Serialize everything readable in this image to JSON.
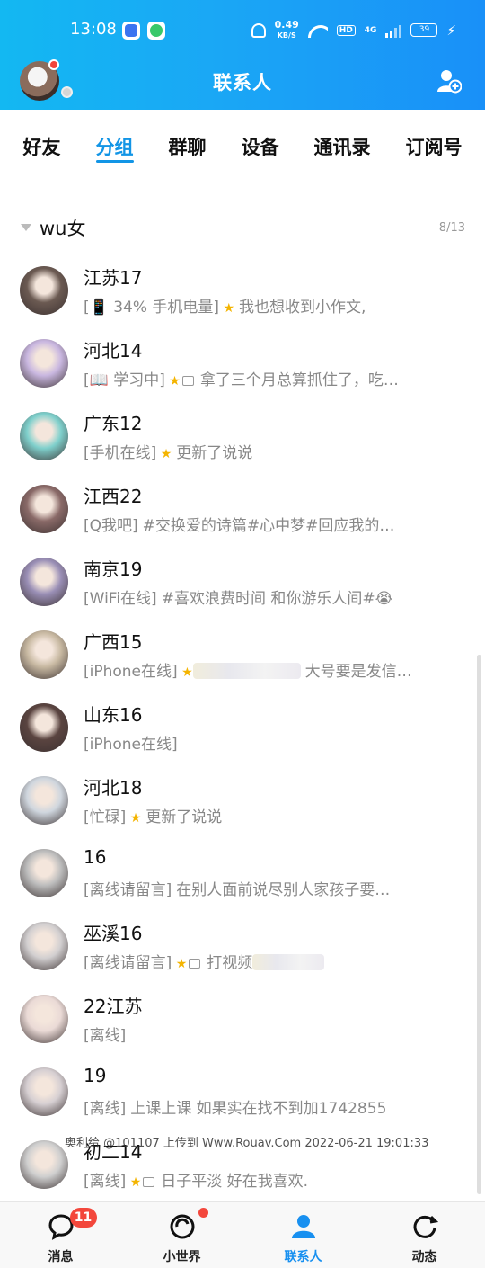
{
  "status_bar": {
    "time": "13:08",
    "net_speed_value": "0.49",
    "net_speed_unit": "KB/S",
    "hd": "HD",
    "signal": "4G",
    "battery": "39"
  },
  "header": {
    "title": "联系人"
  },
  "tabs": [
    {
      "label": "好友",
      "active": false
    },
    {
      "label": "分组",
      "active": true
    },
    {
      "label": "群聊",
      "active": false
    },
    {
      "label": "设备",
      "active": false
    },
    {
      "label": "通讯录",
      "active": false
    },
    {
      "label": "订阅号",
      "active": false
    }
  ],
  "group": {
    "name": "wu女",
    "count": "8/13"
  },
  "contacts": [
    {
      "name": "江苏17",
      "status": "[📱 34% 手机电量]",
      "star": true,
      "img": false,
      "text": "我也想收到小作文,",
      "blur_w": 0
    },
    {
      "name": "河北14",
      "status": "[📖 学习中]",
      "star": true,
      "img": true,
      "text": "拿了三个月总算抓住了，吃…",
      "blur_w": 0
    },
    {
      "name": "广东12",
      "status": "[手机在线]",
      "star": true,
      "img": false,
      "text": "更新了说说",
      "blur_w": 0
    },
    {
      "name": "江西22",
      "status": "[Q我吧]",
      "star": false,
      "img": false,
      "text": "#交换爱的诗篇#心中梦#回应我的…",
      "blur_w": 0
    },
    {
      "name": "南京19",
      "status": "[WiFi在线]",
      "star": false,
      "img": false,
      "text": "#喜欢浪费时间 和你游乐人间#😭",
      "blur_w": 0
    },
    {
      "name": "广西15",
      "status": "[iPhone在线]",
      "star": true,
      "img": false,
      "text": "大号要是发信…",
      "blur_w": 120
    },
    {
      "name": "山东16",
      "status": "[iPhone在线]",
      "star": false,
      "img": false,
      "text": "",
      "blur_w": 0
    },
    {
      "name": "河北18",
      "status": "[忙碌]",
      "star": true,
      "img": false,
      "text": "更新了说说",
      "blur_w": 0
    },
    {
      "name": "16",
      "status": "[离线请留言]",
      "star": false,
      "img": false,
      "text": "在别人面前说尽别人家孩子要…",
      "blur_w": 0
    },
    {
      "name": "巫溪16",
      "status": "[离线请留言]",
      "star": true,
      "img": true,
      "text": "打视频",
      "blur_w": 80
    },
    {
      "name": "22江苏",
      "status": "[离线]",
      "star": false,
      "img": false,
      "text": "",
      "blur_w": 0
    },
    {
      "name": "19",
      "status": "[离线]",
      "star": false,
      "img": false,
      "text": "上课上课 如果实在找不到加1742855",
      "blur_w": 0
    },
    {
      "name": "初二14",
      "status": "[离线]",
      "star": true,
      "img": true,
      "text": "日子平淡 好在我喜欢.",
      "blur_w": 0
    }
  ],
  "avatar_colors": [
    "#6b5a52",
    "#c9b7e0",
    "#7fd0cc",
    "#8a6a68",
    "#9a8fb6",
    "#c8b9a2",
    "#5a4440",
    "#cfd6de",
    "#bdbdbd",
    "#d2cfd0",
    "#eadad6",
    "#d6cfd2",
    "#cfcfcf"
  ],
  "watermark": "奥利给 @101107 上传到 Www.Rouav.Com 2022-06-21 19:01:33",
  "bottom_nav": [
    {
      "label": "消息",
      "badge": "11",
      "active": false,
      "icon": "message-icon"
    },
    {
      "label": "小世界",
      "badge": "",
      "dot": true,
      "active": false,
      "icon": "world-icon"
    },
    {
      "label": "联系人",
      "badge": "",
      "active": true,
      "icon": "contacts-icon"
    },
    {
      "label": "动态",
      "badge": "",
      "active": false,
      "icon": "feed-icon"
    }
  ],
  "colors": {
    "accent": "#1295e6",
    "header_start": "#13b8f2",
    "header_end": "#1990f8",
    "badge": "#f3473c"
  }
}
